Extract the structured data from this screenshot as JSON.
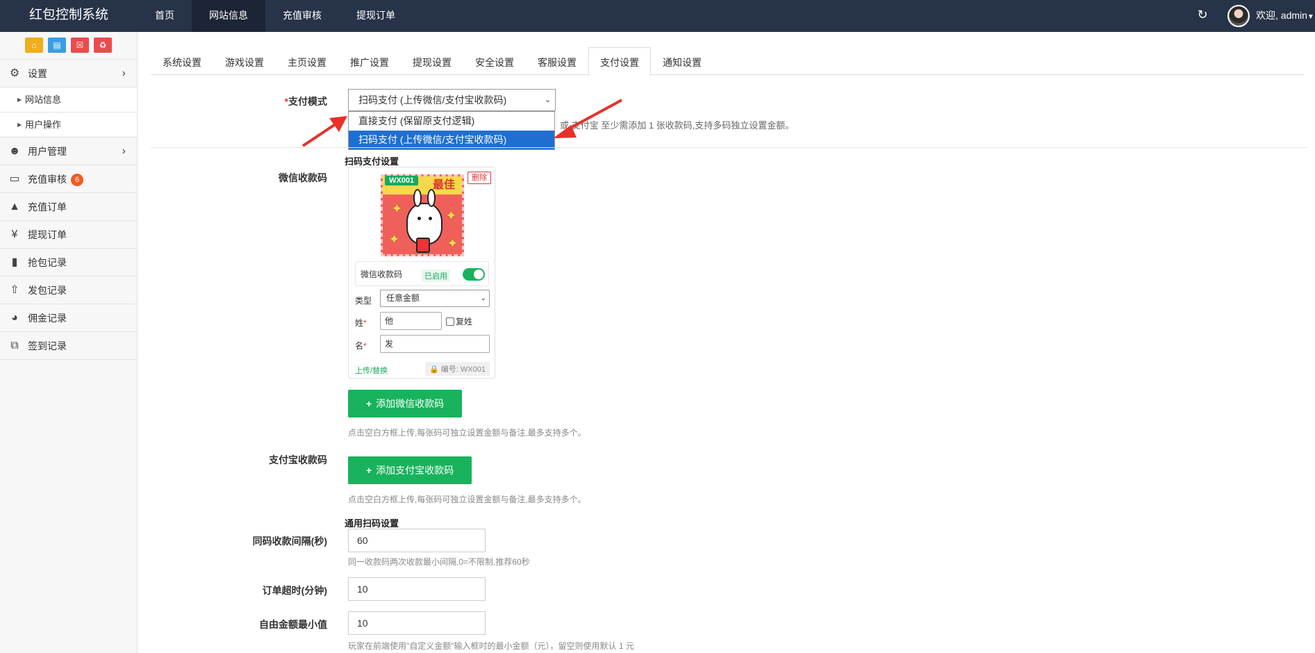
{
  "topbar": {
    "brand": "红包控制系统",
    "nav": [
      "首页",
      "网站信息",
      "充值审核",
      "提现订单"
    ],
    "active_nav": "网站信息",
    "welcome": "欢迎, admin"
  },
  "sidebar": {
    "settings": "设置",
    "sub_items": [
      "网站信息",
      "用户操作"
    ],
    "items": [
      {
        "label": "用户管理",
        "icon": "users-icon"
      },
      {
        "label": "充值审核",
        "icon": "monitor-icon",
        "badge": "6"
      },
      {
        "label": "充值订单",
        "icon": "area-chart-icon"
      },
      {
        "label": "提现订单",
        "icon": "yen-icon"
      },
      {
        "label": "抢包记录",
        "icon": "bar-chart-icon"
      },
      {
        "label": "发包记录",
        "icon": "upload-icon"
      },
      {
        "label": "佣金记录",
        "icon": "pie-chart-icon"
      },
      {
        "label": "签到记录",
        "icon": "clone-icon"
      }
    ]
  },
  "tabs": [
    "系统设置",
    "游戏设置",
    "主页设置",
    "推广设置",
    "提现设置",
    "安全设置",
    "客服设置",
    "支付设置",
    "通知设置"
  ],
  "active_tab": "支付设置",
  "pay_mode": {
    "label": "支付模式",
    "selected": "扫码支付 (上传微信/支付宝收款码)",
    "options": [
      "直接支付 (保留原支付逻辑)",
      "扫码支付 (上传微信/支付宝收款码)"
    ],
    "hint_visible": "或 支付宝 至少需添加 1 张收款码,支持多码独立设置金额。"
  },
  "scan_section_title": "扫码支付设置",
  "wechat": {
    "label": "微信收款码",
    "card": {
      "code": "WX001",
      "delete": "删除",
      "banner_text": "最佳",
      "name": "微信收款码",
      "status": "已启用",
      "type_label": "类型",
      "type_value": "任意金额",
      "surname_label": "姓",
      "surname_value": "他",
      "compound_surname": "复姓",
      "given_label": "名",
      "given_value": "发",
      "upload": "上传/替换",
      "serial": "编号: WX001"
    },
    "add_button": "添加微信收款码",
    "hint": "点击空白方框上传,每张码可独立设置金额与备注,最多支持多个。"
  },
  "alipay": {
    "label": "支付宝收款码",
    "add_button": "添加支付宝收款码",
    "hint": "点击空白方框上传,每张码可独立设置金额与备注,最多支持多个。"
  },
  "general_title": "通用扫码设置",
  "interval": {
    "label": "同码收款间隔(秒)",
    "value": "60",
    "hint": "同一收款码两次收款最小间隔,0=不限制,推荐60秒"
  },
  "timeout": {
    "label": "订单超时(分钟)",
    "value": "10"
  },
  "min_amount": {
    "label": "自由金额最小值",
    "value": "10",
    "hint": "玩家在前端使用\"自定义金额\"输入框时的最小金额（元），留空则使用默认 1 元"
  },
  "colors": {
    "topbar": "#273349",
    "accent_green": "#18b35c",
    "select_blue": "#1f6fd0",
    "arrow_red": "#e8302a"
  }
}
